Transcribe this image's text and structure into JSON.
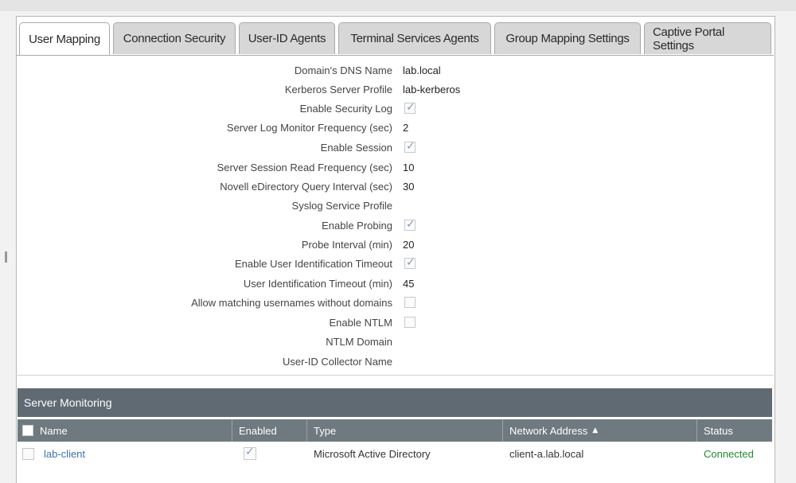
{
  "tabs": [
    {
      "label": "User Mapping",
      "active": true
    },
    {
      "label": "Connection Security",
      "active": false
    },
    {
      "label": "User-ID Agents",
      "active": false
    },
    {
      "label": "Terminal Services Agents",
      "active": false
    },
    {
      "label": "Group Mapping Settings",
      "active": false
    },
    {
      "label": "Captive Portal Settings",
      "active": false
    }
  ],
  "settings": {
    "domain_dns_name": {
      "label": "Domain's DNS Name",
      "value": "lab.local"
    },
    "kerberos_server_profile": {
      "label": "Kerberos Server Profile",
      "value": "lab-kerberos"
    },
    "enable_security_log": {
      "label": "Enable Security Log",
      "checked": true
    },
    "server_log_monitor_frequency": {
      "label": "Server Log Monitor Frequency (sec)",
      "value": "2"
    },
    "enable_session": {
      "label": "Enable Session",
      "checked": true
    },
    "server_session_read_frequency": {
      "label": "Server Session Read Frequency (sec)",
      "value": "10"
    },
    "novell_query_interval": {
      "label": "Novell eDirectory Query Interval (sec)",
      "value": "30"
    },
    "syslog_service_profile": {
      "label": "Syslog Service Profile",
      "value": ""
    },
    "enable_probing": {
      "label": "Enable Probing",
      "checked": true
    },
    "probe_interval": {
      "label": "Probe Interval (min)",
      "value": "20"
    },
    "enable_user_id_timeout": {
      "label": "Enable User Identification Timeout",
      "checked": true
    },
    "user_id_timeout": {
      "label": "User Identification Timeout (min)",
      "value": "45"
    },
    "allow_matching_usernames": {
      "label": "Allow matching usernames without domains",
      "checked": false
    },
    "enable_ntlm": {
      "label": "Enable NTLM",
      "checked": false
    },
    "ntlm_domain": {
      "label": "NTLM Domain",
      "value": ""
    },
    "user_id_collector_name": {
      "label": "User-ID Collector Name",
      "value": ""
    }
  },
  "server_monitoring": {
    "title": "Server Monitoring",
    "columns": {
      "name": "Name",
      "enabled": "Enabled",
      "type": "Type",
      "network_address": "Network Address",
      "status": "Status"
    },
    "rows": [
      {
        "name": "lab-client",
        "enabled": true,
        "type": "Microsoft Active Directory",
        "network_address": "client-a.lab.local",
        "status": "Connected"
      }
    ]
  },
  "colors": {
    "status_connected": "#1e8a2e",
    "link": "#3d73b3",
    "header": "#5f6a72"
  }
}
